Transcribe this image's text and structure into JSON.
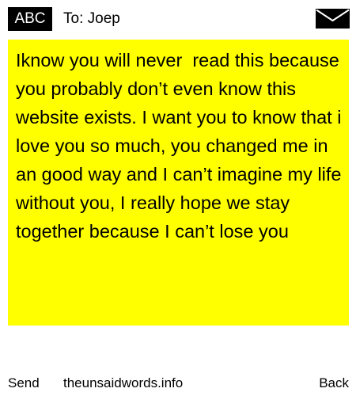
{
  "header": {
    "badge": "ABC",
    "recipient": "To: Joep",
    "icon": "envelope-icon"
  },
  "message": {
    "text": "Iknow you will never  read this because you probably don’t even know this website exists. I want you to know that i love you so much, you changed me in an good way and I can’t imagine my life without you, I really hope we stay together because I can’t lose you",
    "background_color": "#ffff00"
  },
  "footer": {
    "send_label": "Send",
    "site_label": "theunsaidwords.info",
    "back_label": "Back"
  }
}
